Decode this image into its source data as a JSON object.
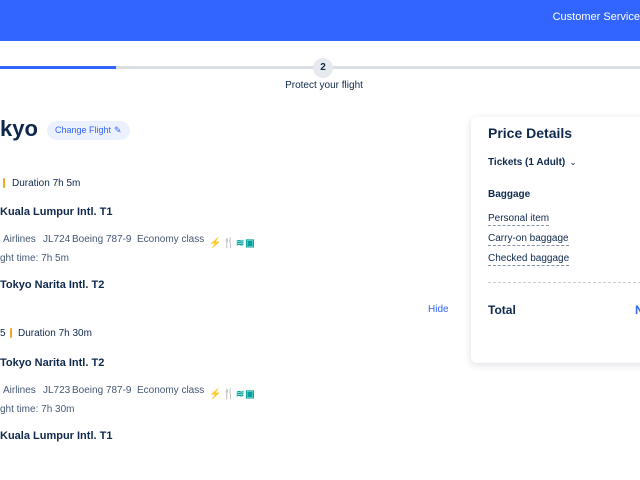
{
  "header": {
    "customer_service": "Customer Service"
  },
  "progress": {
    "step_number": "2",
    "step_label": "Protect your flight"
  },
  "trip": {
    "destination_partial": "kyo",
    "change_flight": "Change Flight",
    "edit_icon": "pencil-icon"
  },
  "outbound": {
    "duration": "Duration 7h 5m",
    "depart_airport": "Kuala Lumpur Intl. T1",
    "airline": "Airlines",
    "flight_no": "JL724",
    "aircraft": "Boeing 787-9",
    "cabin": "Economy class",
    "flight_time": "ght time: 7h 5m",
    "arrive_airport": "Tokyo Narita Intl. T2"
  },
  "hide_label": "Hide",
  "inbound": {
    "duration_prefix": "5",
    "duration": "Duration 7h 30m",
    "depart_airport": "Tokyo Narita Intl. T2",
    "airline": "Airlines",
    "flight_no": "JL723",
    "aircraft": "Boeing 787-9",
    "cabin": "Economy class",
    "flight_time": "ght time: 7h 30m",
    "arrive_airport": "Kuala Lumpur Intl. T1"
  },
  "amenity_icons": [
    "power-icon",
    "meal-icon",
    "wifi-icon",
    "entertainment-icon"
  ],
  "price_details": {
    "title": "Price Details",
    "tickets": "Tickets (1 Adult)",
    "baggage_heading": "Baggage",
    "items": [
      "Personal item",
      "Carry-on baggage",
      "Checked baggage"
    ],
    "total_label": "Total",
    "total_value_partial": "N"
  },
  "colors": {
    "brand": "#3264ff",
    "amenity": "#00a19e",
    "text": "#0f294d"
  }
}
